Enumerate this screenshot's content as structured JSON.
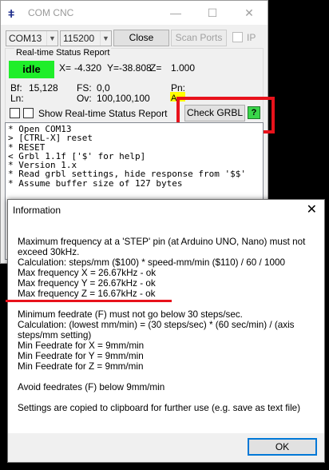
{
  "window": {
    "title": "COM CNC",
    "minimize": "—",
    "maximize": "☐",
    "close": "✕"
  },
  "toolbar": {
    "port": "COM13",
    "baud": "115200",
    "close_button": "Close",
    "scan_ports_button": "Scan Ports",
    "ip_label": "IP"
  },
  "status": {
    "group_title": "Real-time Status Report",
    "state": "idle",
    "x_label": "X=",
    "x_value": "-4.320",
    "y_label": "Y=",
    "y_value": "-38.808",
    "z_label": "Z=",
    "z_value": "1.000",
    "bf_label": "Bf:",
    "bf_value": "15,128",
    "fs_label": "FS:",
    "fs_value": "0,0",
    "pn_label": "Pn:",
    "ln_label": "Ln:",
    "ov_label": "Ov:",
    "ov_value": "100,100,100",
    "pn_value": "A",
    "show_report_label": "Show Real-time Status Report",
    "check_grbl_button": "Check GRBL",
    "help_button": "?"
  },
  "console_lines": [
    "* Open COM13",
    "",
    "> [CTRL-X] reset",
    "* RESET",
    "< Grbl 1.1f ['$' for help]",
    "* Version 1.x",
    "* Read grbl settings, hide response from '$$'",
    "* Assume buffer size of 127 bytes"
  ],
  "dialog": {
    "title": "Information",
    "close": "✕",
    "para1": [
      "Maximum frequency at a 'STEP' pin (at Arduino UNO, Nano) must not exceed 30kHz.",
      "Calculation: steps/mm ($100) * speed-mm/min ($110) / 60 / 1000",
      "Max frequency X = 26.67kHz - ok",
      "Max frequency Y = 26.67kHz - ok",
      "Max frequency Z = 16.67kHz - ok"
    ],
    "para2": [
      "Minimum feedrate (F) must not go below 30 steps/sec.",
      "Calculation: (lowest mm/min) = (30 steps/sec) * (60 sec/min) / (axis steps/mm setting)",
      "Min Feedrate for X = 9mm/min",
      "Min Feedrate for Y = 9mm/min",
      "Min Feedrate for Z = 9mm/min"
    ],
    "para3": "Avoid feedrates (F) below 9mm/min",
    "para4": "Settings are copied to clipboard for further use (e.g. save as text file)",
    "ok_button": "OK"
  }
}
